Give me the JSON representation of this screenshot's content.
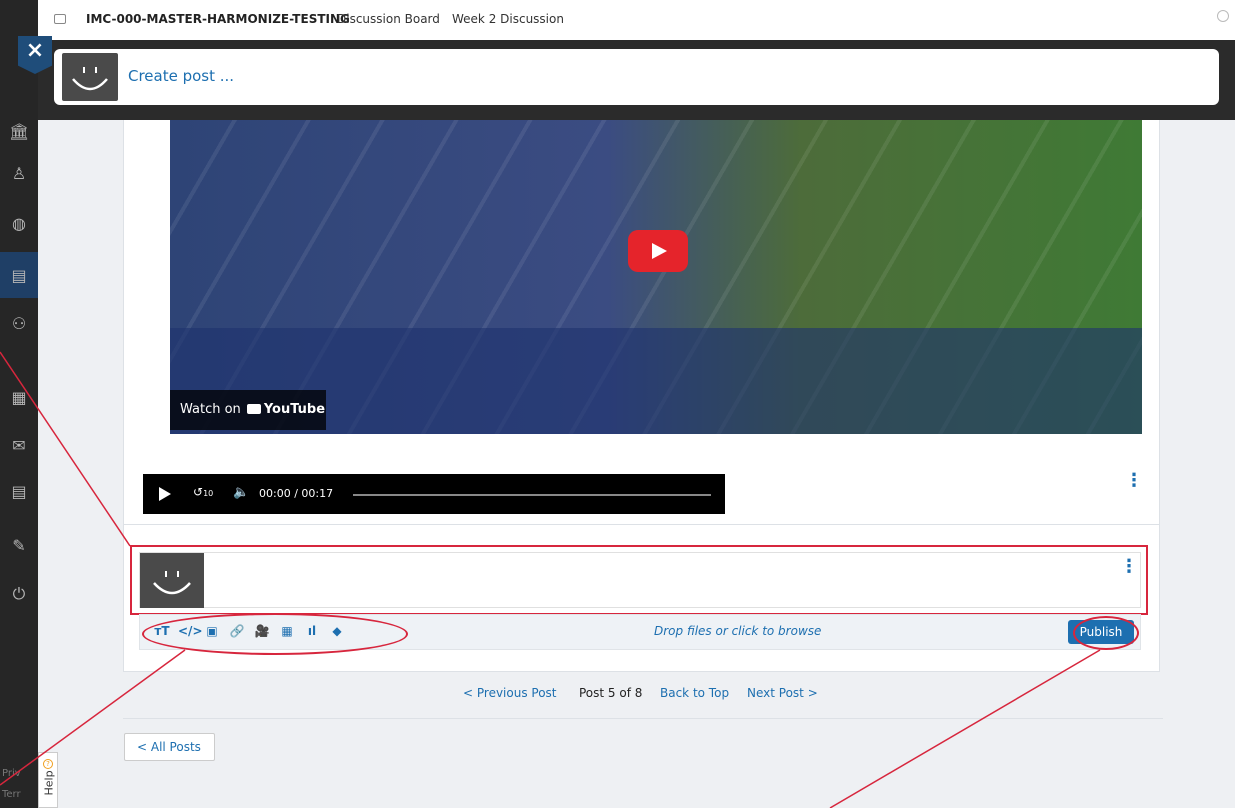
{
  "breadcrumb": {
    "course": "IMC-000-MASTER-HARMONIZE-TESTING",
    "section": "Discussion Board",
    "topic": "Week 2 Discussion"
  },
  "close_label": "×",
  "create_post": {
    "placeholder": "Create post ..."
  },
  "video": {
    "watch_on": "Watch on",
    "brand": "YouTube"
  },
  "audio": {
    "time": "00:00 / 00:17",
    "skip_label": "10"
  },
  "editor": {
    "drop_text": "Drop files or click to browse",
    "publish_label": "Publish",
    "tools": [
      {
        "name": "text-size",
        "glyph": "тT"
      },
      {
        "name": "code",
        "glyph": "</>"
      },
      {
        "name": "image",
        "glyph": "▣"
      },
      {
        "name": "link",
        "glyph": "🔗"
      },
      {
        "name": "video",
        "glyph": "🎥"
      },
      {
        "name": "calendar",
        "glyph": "▦"
      },
      {
        "name": "chart",
        "glyph": "ıl"
      },
      {
        "name": "tag",
        "glyph": "◆"
      }
    ]
  },
  "pagination": {
    "previous": "< Previous Post",
    "count": "Post 5 of 8",
    "back_to_top": "Back to Top",
    "next": "Next Post >"
  },
  "all_posts": "< All Posts",
  "help_label": "Help",
  "footer": {
    "priv": "Priv",
    "term": "Terr"
  },
  "colors": {
    "accent": "#1d6fb0",
    "annotation": "#d7263d",
    "nav": "#262626"
  }
}
